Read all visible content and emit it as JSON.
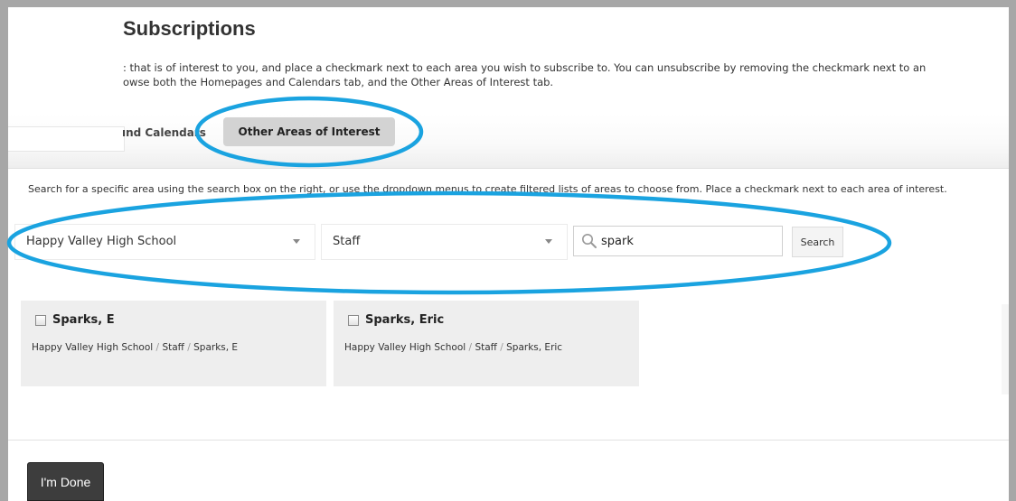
{
  "page": {
    "title": "Subscriptions"
  },
  "intro": {
    "line1": ": that is of interest to you, and place a checkmark next to each area you wish to subscribe to. You can unsubscribe by removing the checkmark next to an",
    "line2": "owse both the Homepages and Calendars tab, and the Other Areas of Interest tab."
  },
  "tabs": {
    "previous_label": "ınd Calendars",
    "active_label": "Other Areas of Interest"
  },
  "filters": {
    "description": "Search for a specific area using the search box on the right, or use the dropdown menus to create filtered lists of areas to choose from. Place a checkmark next to each area of interest.",
    "site_select_value": "Happy Valley High School",
    "category_select_value": "Staff",
    "search_value": "spark",
    "search_button_label": "Search"
  },
  "results": [
    {
      "name": "Sparks, E",
      "path": [
        "Happy Valley High School",
        "Staff",
        "Sparks, E"
      ],
      "checked": false
    },
    {
      "name": "Sparks, Eric",
      "path": [
        "Happy Valley High School",
        "Staff",
        "Sparks, Eric"
      ],
      "checked": false
    }
  ],
  "path_separator": "/",
  "footer": {
    "done_label": "I'm Done"
  },
  "colors": {
    "highlight_ring": "#1aa3e0",
    "frame": "#a7a7a7",
    "active_tab": "#d3d3d3",
    "card_bg": "#eeeeee",
    "done_button": "#3d3d3d"
  },
  "icons": {
    "search": "magnifier-icon",
    "dropdown": "caret-down-icon",
    "checkbox": "checkbox-unchecked"
  }
}
